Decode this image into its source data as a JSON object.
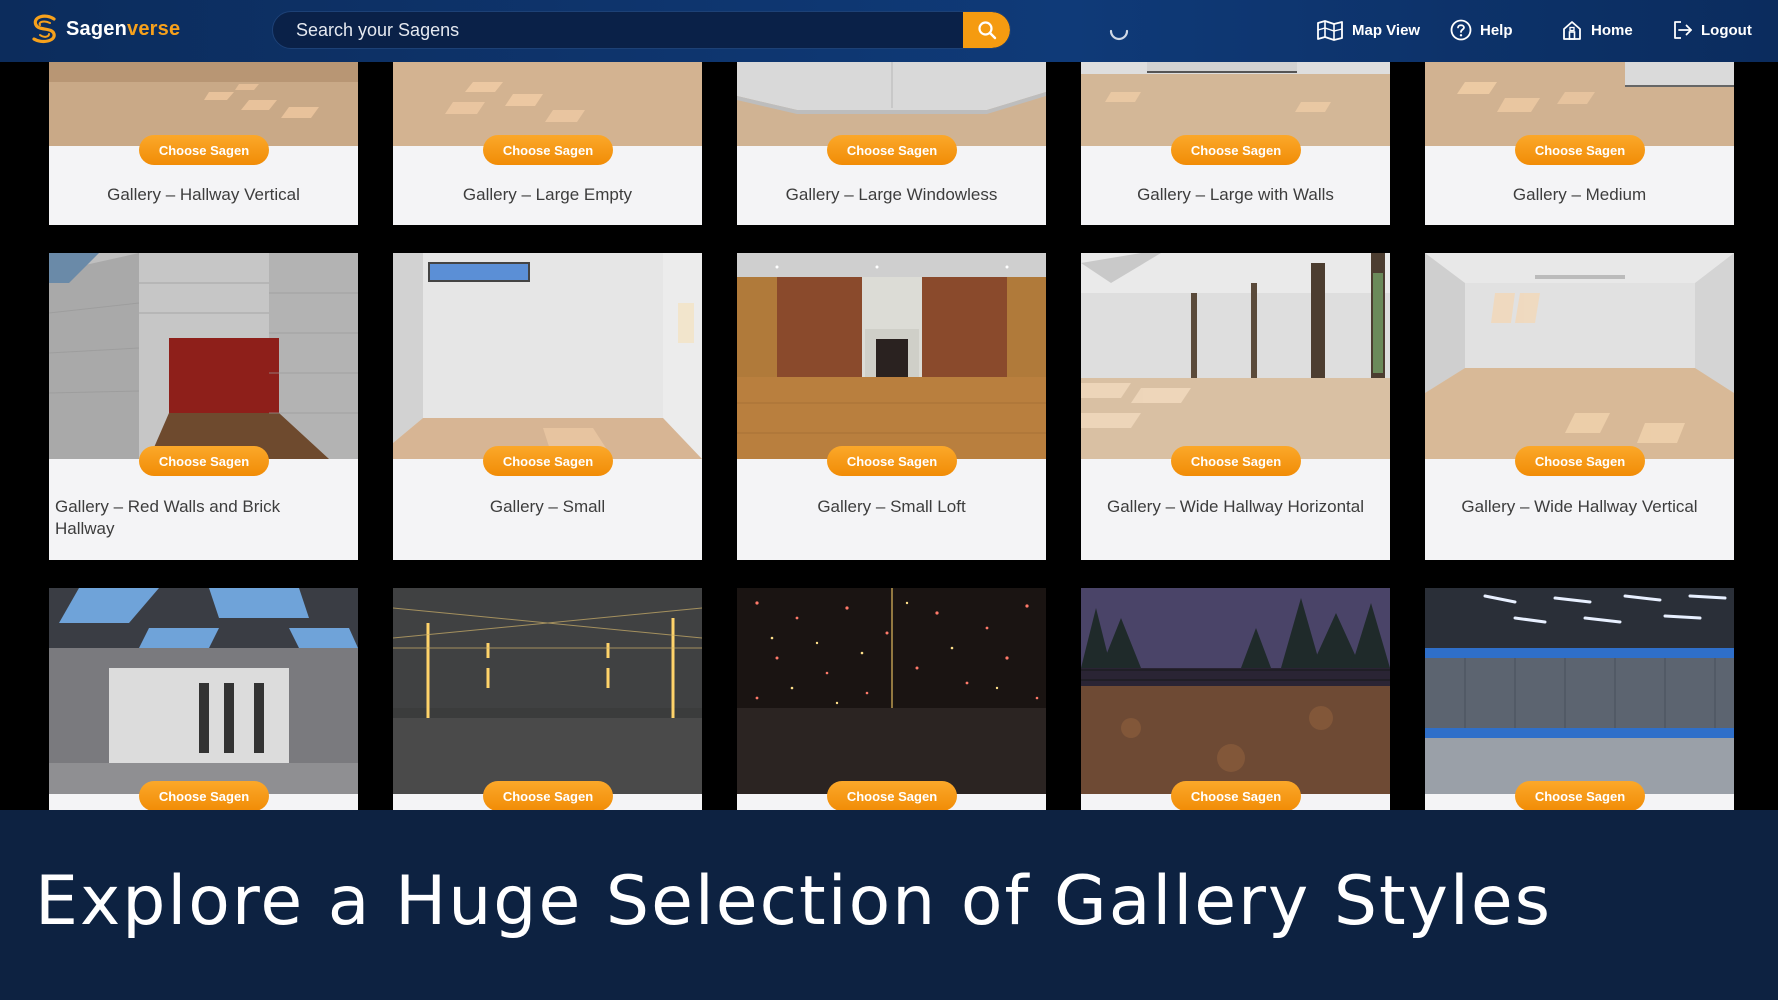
{
  "header": {
    "logo_prefix": "Sagen",
    "logo_suffix": "verse",
    "search_placeholder": "Search your Sagens",
    "nav": {
      "map_view": "Map View",
      "help": "Help",
      "home": "Home",
      "logout": "Logout"
    }
  },
  "colors": {
    "header_bg": "#0f3a78",
    "accent": "#f59b10",
    "banner_bg": "#0d2241"
  },
  "choose_label": "Choose Sagen",
  "rows": [
    [
      {
        "title": "Gallery – Hallway Vertical"
      },
      {
        "title": "Gallery – Large Empty"
      },
      {
        "title": "Gallery – Large Windowless"
      },
      {
        "title": "Gallery – Large with Walls"
      },
      {
        "title": "Gallery – Medium"
      }
    ],
    [
      {
        "title": "Gallery – Red Walls and Brick Hallway"
      },
      {
        "title": "Gallery – Small"
      },
      {
        "title": "Gallery – Small Loft"
      },
      {
        "title": "Gallery – Wide Hallway Horizontal"
      },
      {
        "title": "Gallery – Wide Hallway Vertical"
      }
    ],
    [
      {
        "title": ""
      },
      {
        "title": ""
      },
      {
        "title": ""
      },
      {
        "title": ""
      },
      {
        "title": ""
      }
    ]
  ],
  "banner": {
    "text": "Explore a Huge Selection of Gallery Styles"
  }
}
